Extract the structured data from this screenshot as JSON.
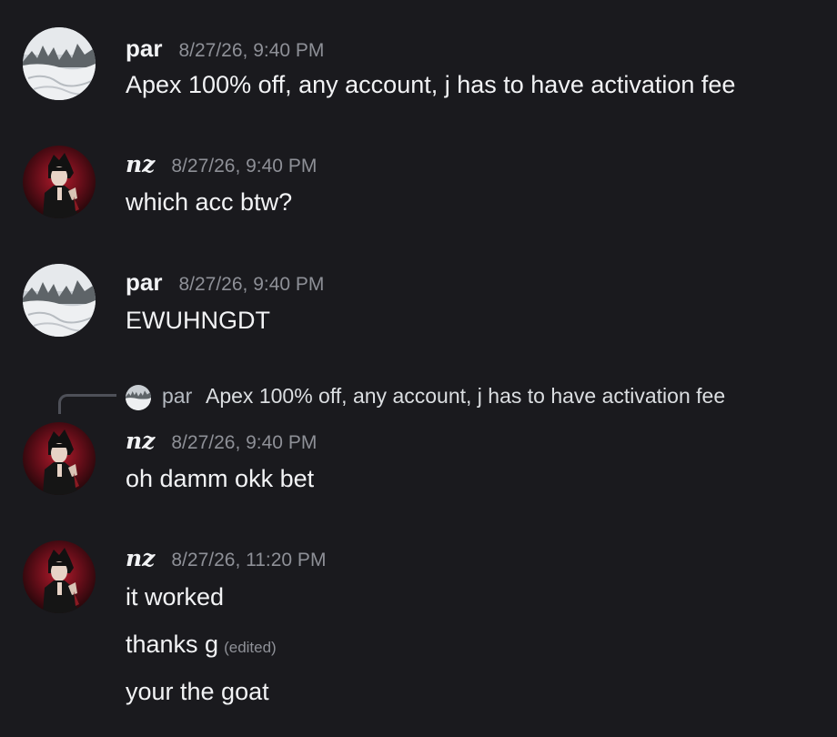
{
  "messages": [
    {
      "author": "par",
      "timestamp": "8/27/26, 9:40 PM",
      "lines": [
        "Apex 100% off, any account, j has to have activation fee"
      ]
    },
    {
      "author": "nz",
      "timestamp": "8/27/26, 9:40 PM",
      "lines": [
        "which acc btw?"
      ]
    },
    {
      "author": "par",
      "timestamp": "8/27/26, 9:40 PM",
      "lines": [
        "EWUHNGDT"
      ]
    },
    {
      "reply_to": {
        "author": "par",
        "text": "Apex 100% off, any account, j has to have activation fee"
      },
      "author": "nz",
      "timestamp": "8/27/26, 9:40 PM",
      "lines": [
        "oh damm okk bet"
      ]
    },
    {
      "author": "nz",
      "timestamp": "8/27/26, 11:20 PM",
      "lines": [
        "it worked",
        "thanks g",
        "your the goat"
      ],
      "edited_label": "(edited)"
    }
  ],
  "colors": {
    "background": "#1a1a1e",
    "text": "#f2f3f5",
    "muted": "#8e9097",
    "reply_spine": "#4e5058"
  },
  "icons": {
    "par_avatar": "snowy-landscape-avatar",
    "nz_avatar": "anime-character-avatar"
  }
}
